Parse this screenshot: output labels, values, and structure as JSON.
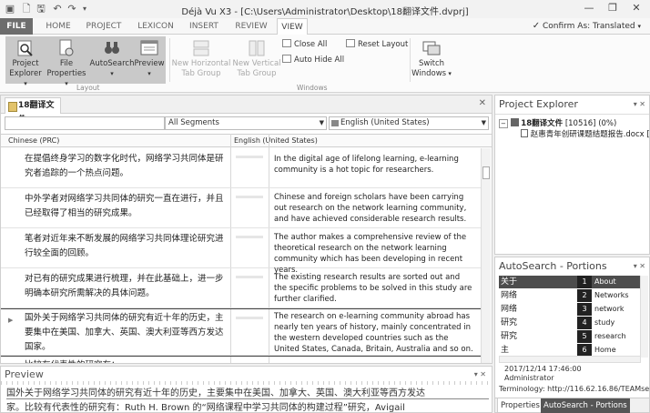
{
  "titlebar": {
    "title": "Déjà Vu X3 - [C:\\Users\\Administrator\\Desktop\\18翻译文件.dvprj]",
    "minimize": "—",
    "restore": "❐",
    "close": "✕"
  },
  "menu": {
    "tabs": [
      "FILE",
      "HOME",
      "PROJECT",
      "LEXICON",
      "INSERT",
      "REVIEW",
      "VIEW"
    ],
    "confirm_label": "Confirm As: Translated"
  },
  "ribbon": {
    "project_explorer": "Project\nExplorer",
    "file_properties": "File\nProperties",
    "autosearch": "AutoSearch",
    "preview": "Preview",
    "layout_group": "Layout",
    "new_horizontal": "New Horizontal\nTab Group",
    "new_vertical": "New Vertical\nTab Group",
    "close_all": "Close All",
    "auto_hide_all": "Auto Hide All",
    "reset_layout": "Reset Layout",
    "switch_windows": "Switch\nWindows",
    "windows_group": "Windows"
  },
  "document": {
    "tab_label": "18翻译文件",
    "filter_value": "All Segments",
    "language_value": "English (United States)",
    "col_source": "Chinese (PRC)",
    "col_target": "English (United States)",
    "rows": [
      {
        "src": "在提倡终身学习的数字化时代，网络学习共同体是研究者追踪的一个热点问题。",
        "tgt": "In the digital age of lifelong learning, e-learning community is a hot topic for researchers."
      },
      {
        "src": "中外学者对网络学习共同体的研究一直在进行，并且已经取得了相当的研究成果。",
        "tgt": "Chinese and foreign scholars have been carrying out research on the network learning community, and have achieved considerable research results."
      },
      {
        "src": "笔者对近年来不断发展的网络学习共同体理论研究进行较全面的回顾。",
        "tgt": "The author makes a comprehensive review of the theoretical research on the network learning community which has been developing in recent years."
      },
      {
        "src": "对已有的研究成果进行梳理，并在此基础上，进一步明确本研究所需解决的具体问题。",
        "tgt": "The existing research results are sorted out and the specific problems to be solved in this study are further clarified."
      },
      {
        "src": "国外关于网络学习共同体的研究有近十年的历史，主要集中在美国、加拿大、英国、澳大利亚等西方发达国家。",
        "tgt": "The research on e-learning community abroad has nearly ten years of history, mainly concentrated in the western developed countries such as the United States, Canada, Britain, Australia and so on."
      },
      {
        "src": "比较有代表性的研究有：",
        "tgt": ""
      }
    ]
  },
  "preview": {
    "title": "Preview",
    "pin": "▾ ✕",
    "line1": "国外关于网络学习共同体的研究有近十年的历史，主要集中在美国、加拿大、英国、澳大利亚等西方发达",
    "line2": "家。比较有代表性的研究有：Ruth H. Brown 的“网络课程中学习共同体的构建过程”研究，Avigail"
  },
  "project_explorer": {
    "title": "Project Explorer",
    "controls": "▾ ✕",
    "project_name": "18翻译文件",
    "project_stats": "[10516] (0%)",
    "file_name": "赵惠青年创研课题结题报告.docx [L"
  },
  "autosearch": {
    "title": "AutoSearch - Portions",
    "controls": "▾ ✕",
    "rows": [
      {
        "word": "关于",
        "num": "1",
        "trans": "About"
      },
      {
        "word": "网络",
        "num": "2",
        "trans": "Networks"
      },
      {
        "word": "网络",
        "num": "3",
        "trans": "network"
      },
      {
        "word": "研究",
        "num": "4",
        "trans": "study"
      },
      {
        "word": "研究",
        "num": "5",
        "trans": "research"
      },
      {
        "word": "主",
        "num": "6",
        "trans": "Home"
      }
    ],
    "info_date": "2017/12/14 17:46:00",
    "info_user": "Administrator",
    "info_term": "Terminology: http://116.62.16.86/TEAMserver/",
    "tab_properties": "Properties",
    "tab_autosearch": "AutoSearch - Portions"
  }
}
